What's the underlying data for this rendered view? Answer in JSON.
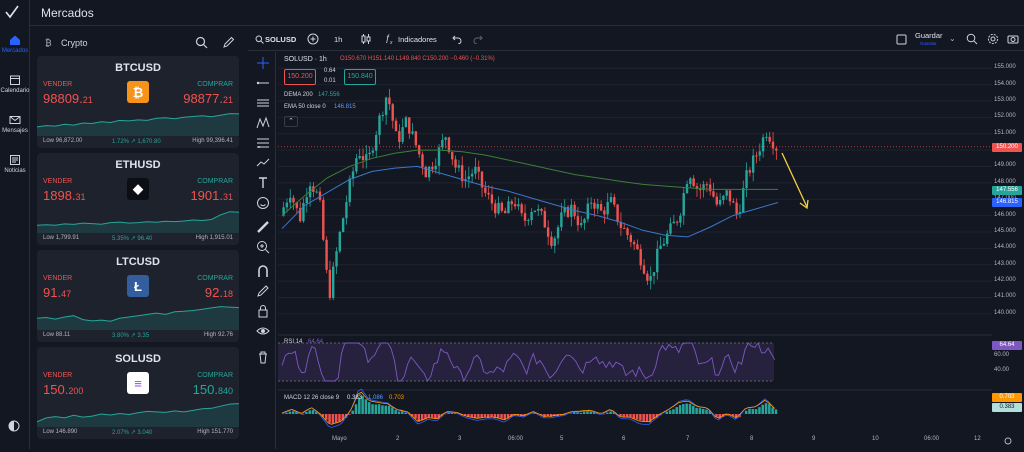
{
  "rail": {
    "items": [
      {
        "label": "Mercados",
        "icon": "home-icon",
        "active": true
      },
      {
        "label": "Calendario",
        "icon": "calendar-icon"
      },
      {
        "label": "Mensajes",
        "icon": "mail-icon"
      },
      {
        "label": "Noticias",
        "icon": "news-icon"
      }
    ]
  },
  "header": {
    "title": "Mercados"
  },
  "panel": {
    "category_label": "Crypto",
    "category_glyph": "₿"
  },
  "cards": [
    {
      "symbol": "BTCUSD",
      "sell_label": "VENDER",
      "buy_label": "COMPRAR",
      "sell_main": "98809.",
      "sell_sub": "21",
      "buy_main": "98877.",
      "buy_sub": "21",
      "low": "Low 96,872.00",
      "change": "1.72% ↗ 1,670.80",
      "high": "High 99,396.41",
      "coin_color": "#f7931a",
      "coin_glyph": "₿",
      "spark": [
        0.35,
        0.4,
        0.38,
        0.45,
        0.42,
        0.5,
        0.48,
        0.55,
        0.52,
        0.6,
        0.58,
        0.62,
        0.6,
        0.68,
        0.7,
        0.66,
        0.72,
        0.75,
        0.78,
        0.74,
        0.8,
        0.86,
        0.85
      ]
    },
    {
      "symbol": "ETHUSD",
      "sell_label": "VENDER",
      "buy_label": "COMPRAR",
      "sell_main": "1898.",
      "sell_sub": "31",
      "buy_main": "1901.",
      "buy_sub": "31",
      "low": "Low 1,799.91",
      "change": "5.35% ↗ 96.40",
      "high": "High 1,915.01",
      "coin_color": "#0b0e14",
      "coin_glyph": "◆",
      "spark": [
        0.3,
        0.32,
        0.3,
        0.35,
        0.33,
        0.38,
        0.36,
        0.34,
        0.4,
        0.42,
        0.38,
        0.4,
        0.43,
        0.41,
        0.45,
        0.44,
        0.46,
        0.5,
        0.48,
        0.52,
        0.7,
        0.82,
        0.8
      ]
    },
    {
      "symbol": "LTCUSD",
      "sell_label": "VENDER",
      "buy_label": "COMPRAR",
      "sell_main": "91.",
      "sell_sub": "47",
      "buy_main": "92.",
      "buy_sub": "18",
      "low": "Low 88.11",
      "change": "3.80% ↗ 3.35",
      "high": "High 92.76",
      "coin_color": "#345d9d",
      "coin_glyph": "Ł",
      "spark": [
        0.45,
        0.48,
        0.42,
        0.5,
        0.55,
        0.4,
        0.35,
        0.38,
        0.34,
        0.45,
        0.5,
        0.55,
        0.6,
        0.65,
        0.6,
        0.7,
        0.72,
        0.75,
        0.8,
        0.85,
        0.9,
        0.88,
        0.86
      ]
    },
    {
      "symbol": "SOLUSD",
      "sell_label": "VENDER",
      "buy_label": "COMPRAR",
      "sell_main": "150.",
      "sell_sub": "200",
      "buy_main": "150.",
      "buy_sub": "840",
      "low": "Low 146.890",
      "change": "2.07% ↗ 3.040",
      "high": "High 151.770",
      "coin_color": "#ffffff",
      "coin_glyph": "≡",
      "spark": [
        0.2,
        0.35,
        0.4,
        0.35,
        0.45,
        0.38,
        0.42,
        0.5,
        0.46,
        0.52,
        0.48,
        0.55,
        0.6,
        0.58,
        0.56,
        0.62,
        0.58,
        0.64,
        0.7,
        0.72,
        0.8,
        0.88,
        0.9
      ]
    }
  ],
  "toolbar": {
    "symbol": "SOLUSD",
    "interval": "1h",
    "indicators": "Indicadores",
    "save": "Guardar",
    "save_sub": "Guardar"
  },
  "legend": {
    "title": "SOLUSD · 1h",
    "ohlc": "O150.670 H151.140 L149.840 C150.200 −0.460 (−0.31%)",
    "sell_box": "150.200",
    "buy_box": "150.840",
    "spread_top": "0.64",
    "spread_bottom": "0.01",
    "dema_label": "DEMA 200",
    "dema_value": "147.556",
    "ema_label": "EMA 50 close 0",
    "ema_value": "146.815"
  },
  "rsi": {
    "label": "RSI 14",
    "value": "64.64",
    "ticks": [
      "60.00",
      "40.00"
    ]
  },
  "macd": {
    "label": "MACD 12 26 close 9",
    "v1": "0.383",
    "v2": "1.086",
    "v3": "0.703",
    "badge1": "0.703",
    "badge2": "0.383"
  },
  "price_scale": {
    "ticks": [
      "155.000",
      "154.000",
      "153.000",
      "152.000",
      "151.000",
      "150.000",
      "149.000",
      "148.000",
      "147.000",
      "146.000",
      "145.000",
      "144.000",
      "143.000",
      "142.000",
      "141.000",
      "140.000"
    ],
    "current": "150.200",
    "dema": "147.556",
    "ema": "146.815"
  },
  "time_axis": [
    "Mayo",
    "2",
    "3",
    "06:00",
    "5",
    "6",
    "7",
    "8",
    "9",
    "10",
    "06:00",
    "12"
  ],
  "colors": {
    "up": "#26a69a",
    "down": "#ef5350",
    "bg": "#131722",
    "panel": "#1e222d",
    "accent": "#2962ff",
    "dema": "#3f7d3a",
    "ema": "#3a78c9",
    "rsi": "#7e57c2",
    "annotation_arrow": "#f5d142"
  },
  "chart_data": {
    "type": "candlestick",
    "symbol": "SOLUSD",
    "interval": "1h",
    "y_range": [
      139.5,
      155.5
    ],
    "close_path": [
      146.0,
      147.5,
      145.8,
      148.2,
      147.0,
      141.0,
      144.5,
      147.5,
      150.0,
      149.2,
      151.5,
      153.5,
      150.5,
      151.8,
      150.2,
      148.6,
      149.5,
      150.9,
      149.0,
      148.2,
      148.8,
      147.4,
      146.6,
      146.0,
      147.0,
      145.6,
      146.6,
      145.8,
      144.4,
      146.0,
      146.5,
      145.2,
      147.0,
      146.2,
      146.8,
      145.4,
      144.6,
      143.5,
      142.0,
      144.0,
      145.0,
      146.0,
      148.8,
      147.5,
      148.0,
      146.5,
      147.4,
      146.0,
      148.5,
      149.8,
      151.2,
      150.2
    ],
    "dema200": [
      146.0,
      147.2,
      148.3,
      149.0,
      149.5,
      149.8,
      150.0,
      150.0,
      149.9,
      149.7,
      149.4,
      149.1,
      148.8,
      148.5,
      148.3,
      148.1,
      147.9,
      147.8,
      147.7,
      147.6,
      147.6,
      147.6,
      147.6
    ],
    "ema50": [
      145.2,
      146.6,
      147.4,
      148.2,
      148.7,
      148.9,
      149.0,
      148.6,
      148.2,
      147.8,
      147.5,
      147.1,
      146.7,
      146.3,
      146.0,
      145.6,
      145.1,
      144.8,
      144.7,
      145.3,
      146.0,
      146.4,
      146.8
    ]
  }
}
